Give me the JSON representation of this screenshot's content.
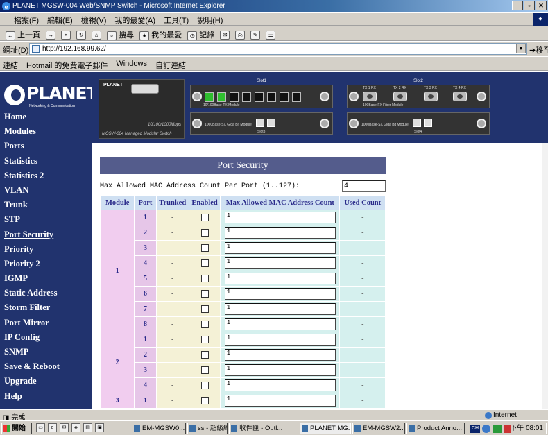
{
  "window": {
    "title": "PLANET MGSW-004 Web/SNMP Switch - Microsoft Internet Explorer",
    "minimize": "_",
    "restore": "▫",
    "close": "✕"
  },
  "menubar": {
    "items": [
      "檔案(F)",
      "編輯(E)",
      "檢視(V)",
      "我的最愛(A)",
      "工具(T)",
      "說明(H)"
    ]
  },
  "toolbar": {
    "back": "上一頁",
    "search": "搜尋",
    "favorites": "我的最愛",
    "history": "記錄"
  },
  "address": {
    "label": "網址(D)",
    "url": "http://192.168.99.62/",
    "go": "移至"
  },
  "links": {
    "label": "連結",
    "items": [
      "Hotmail 的免費電子郵件",
      "Windows",
      "自訂連結"
    ]
  },
  "logo": {
    "text": "PLANET",
    "tagline": "Networking & Communication"
  },
  "nav": {
    "items": [
      "Home",
      "Modules",
      "Ports",
      "Statistics",
      "Statistics 2",
      "VLAN",
      "Trunk",
      "STP",
      "Port Security",
      "Priority",
      "Priority 2",
      "IGMP",
      "Static Address",
      "Storm Filter",
      "Port Mirror",
      "IP Config",
      "SNMP",
      "Save & Reboot",
      "Upgrade",
      "Help"
    ],
    "active": "Port Security"
  },
  "device": {
    "brand": "PLANET",
    "speed": "10/100/1000Mbps",
    "model": "MGSW-004 Managed Modular Switch",
    "slots": [
      "Slot1",
      "Slot2",
      "Slot3",
      "Slot4"
    ],
    "slot1_module": "10/100Base-TX Module",
    "slot2_module": "100Base-FX Fiber Module",
    "slot3_module": "1000Base-SX Giga Bit Module",
    "slot4_module": "1000Base-SX Giga Bit Module",
    "fx_labels": [
      "TX 1 RX",
      "TX 2 RX",
      "TX 3 RX",
      "TX 4 RX"
    ]
  },
  "page": {
    "title": "Port Security",
    "max_label": "Max Allowed MAC Address Count Per Port (1..127):",
    "max_value": "4"
  },
  "table": {
    "headers": [
      "Module",
      "Port",
      "Trunked",
      "Enabled",
      "Max Allowed MAC Address Count",
      "Used Count"
    ],
    "rows": [
      {
        "module": "1",
        "port": "1",
        "trunked": "-",
        "enabled": false,
        "max": "1",
        "used": "-"
      },
      {
        "module": "1",
        "port": "2",
        "trunked": "-",
        "enabled": false,
        "max": "1",
        "used": "-"
      },
      {
        "module": "1",
        "port": "3",
        "trunked": "-",
        "enabled": false,
        "max": "1",
        "used": "-"
      },
      {
        "module": "1",
        "port": "4",
        "trunked": "-",
        "enabled": false,
        "max": "1",
        "used": "-"
      },
      {
        "module": "1",
        "port": "5",
        "trunked": "-",
        "enabled": false,
        "max": "1",
        "used": "-"
      },
      {
        "module": "1",
        "port": "6",
        "trunked": "-",
        "enabled": false,
        "max": "1",
        "used": "-"
      },
      {
        "module": "1",
        "port": "7",
        "trunked": "-",
        "enabled": false,
        "max": "1",
        "used": "-"
      },
      {
        "module": "1",
        "port": "8",
        "trunked": "-",
        "enabled": false,
        "max": "1",
        "used": "-"
      },
      {
        "module": "2",
        "port": "1",
        "trunked": "-",
        "enabled": false,
        "max": "1",
        "used": "-"
      },
      {
        "module": "2",
        "port": "2",
        "trunked": "-",
        "enabled": false,
        "max": "1",
        "used": "-"
      },
      {
        "module": "2",
        "port": "3",
        "trunked": "-",
        "enabled": false,
        "max": "1",
        "used": "-"
      },
      {
        "module": "2",
        "port": "4",
        "trunked": "-",
        "enabled": false,
        "max": "1",
        "used": "-"
      },
      {
        "module": "3",
        "port": "1",
        "trunked": "-",
        "enabled": false,
        "max": "1",
        "used": "-"
      }
    ]
  },
  "statusbar": {
    "status": "完成",
    "zone": "Internet"
  },
  "taskbar": {
    "start": "開始",
    "buttons": [
      "EM-MGSW0...",
      "ss - 超級終端...",
      "收件匣 - Outl...",
      "PLANET MG...",
      "EM-MGSW2...",
      "Product Anno..."
    ],
    "active_index": 3,
    "ime": "CH",
    "clock": "下午 08:01"
  },
  "colors": {
    "nav_bg": "#21336e",
    "header_bg": "#545c8c",
    "module_cell": "#f1cdef",
    "port_cell": "#e6c6e8",
    "cream_cell": "#f4f1d6",
    "mint_cell": "#d5f0ee",
    "header_cell": "#cfe0f2"
  }
}
